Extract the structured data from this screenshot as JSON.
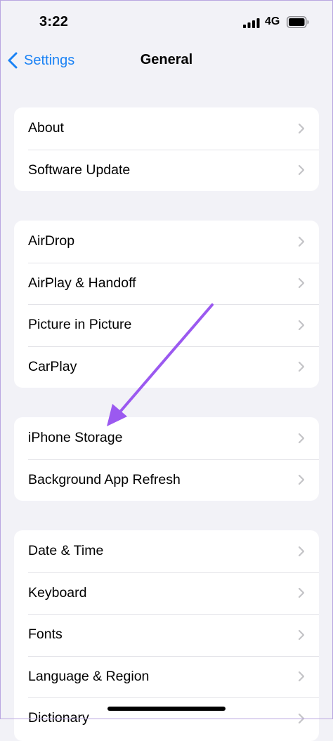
{
  "status_bar": {
    "time": "3:22",
    "network": "4G"
  },
  "nav": {
    "back_label": "Settings",
    "title": "General",
    "accent_color": "#1a82f5"
  },
  "groups": [
    {
      "rows": [
        {
          "label": "About"
        },
        {
          "label": "Software Update"
        }
      ]
    },
    {
      "rows": [
        {
          "label": "AirDrop"
        },
        {
          "label": "AirPlay & Handoff"
        },
        {
          "label": "Picture in Picture"
        },
        {
          "label": "CarPlay"
        }
      ]
    },
    {
      "rows": [
        {
          "label": "iPhone Storage"
        },
        {
          "label": "Background App Refresh"
        }
      ]
    },
    {
      "rows": [
        {
          "label": "Date & Time"
        },
        {
          "label": "Keyboard"
        },
        {
          "label": "Fonts"
        },
        {
          "label": "Language & Region"
        },
        {
          "label": "Dictionary"
        }
      ]
    }
  ],
  "annotation": {
    "type": "arrow",
    "color": "#9b59f0",
    "points_to": "iPhone Storage"
  }
}
